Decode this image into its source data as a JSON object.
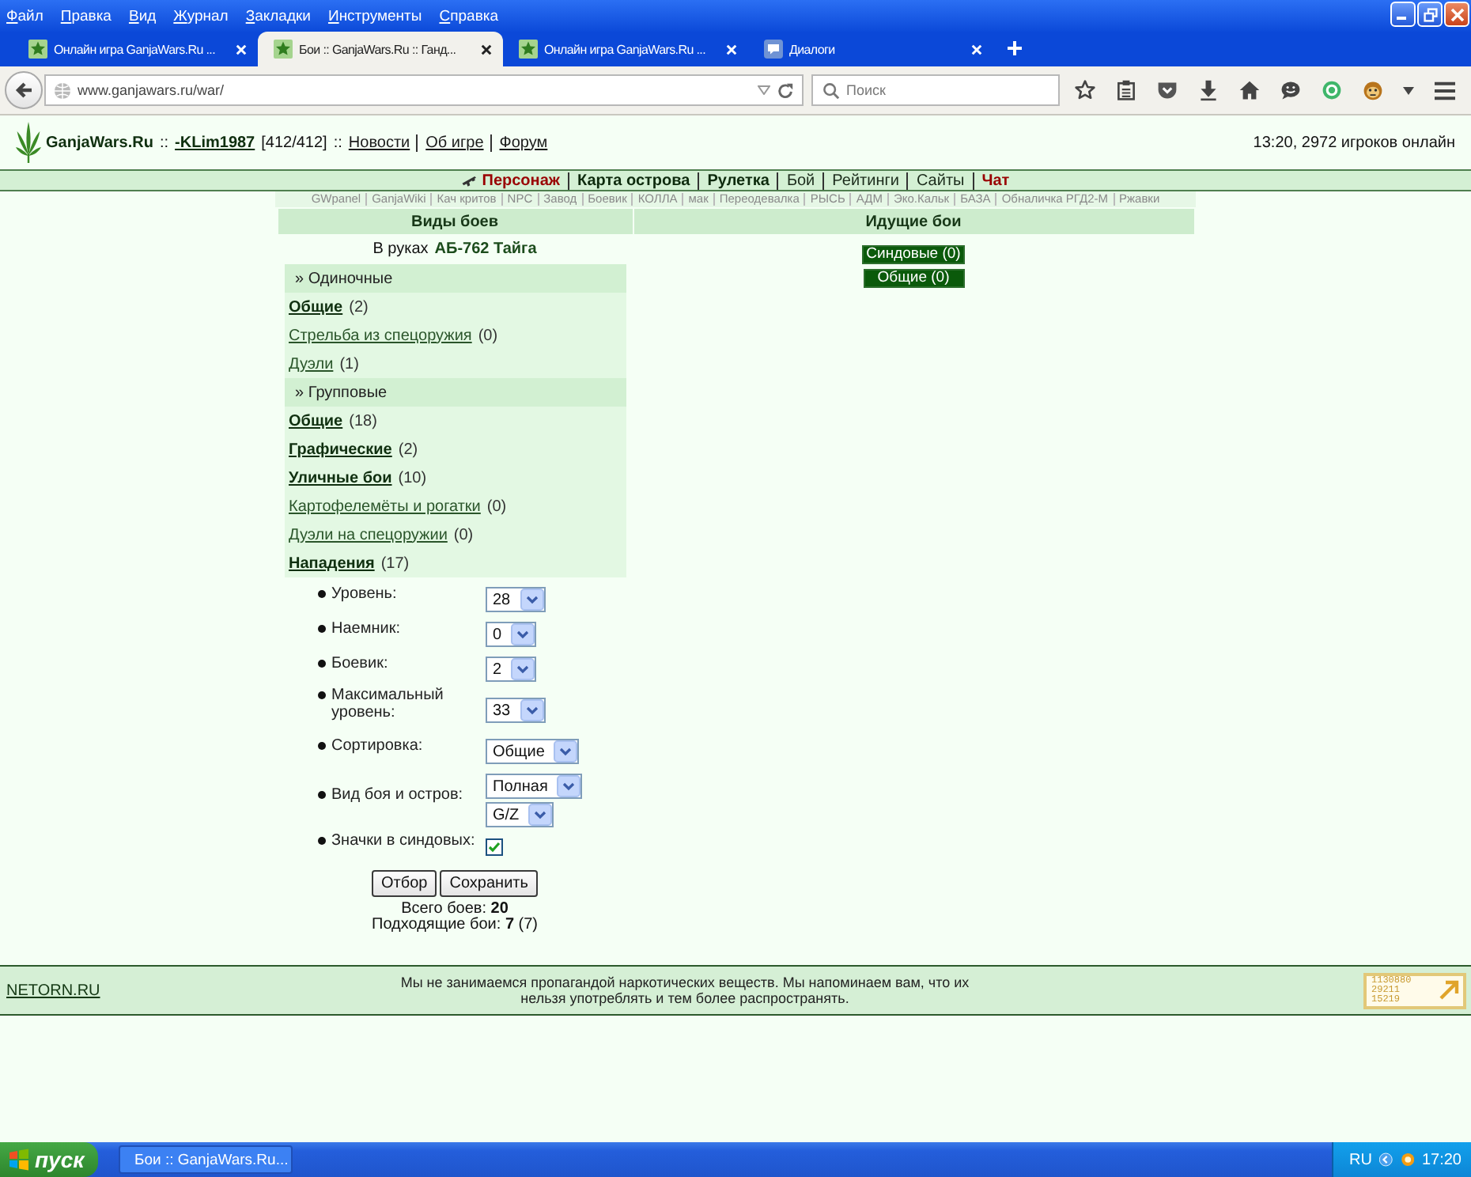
{
  "browser": {
    "menu": [
      "Файл",
      "Правка",
      "Вид",
      "Журнал",
      "Закладки",
      "Инструменты",
      "Справка"
    ],
    "tabs": [
      {
        "title": "Онлайн игра GanjaWars.Ru ...",
        "kind": "site",
        "selected": false
      },
      {
        "title": "Бои :: GanjaWars.Ru :: Ганд...",
        "kind": "site",
        "selected": true
      },
      {
        "title": "Онлайн игра GanjaWars.Ru ...",
        "kind": "site",
        "selected": false
      },
      {
        "title": "Диалоги",
        "kind": "chat",
        "selected": false
      }
    ],
    "address": "www.ganjawars.ru/war/",
    "search": {
      "placeholder": "Поиск"
    }
  },
  "header": {
    "segments": [
      {
        "kind": "brand",
        "text": "GanjaWars.Ru"
      },
      {
        "kind": "sep",
        "text": "::"
      },
      {
        "kind": "user",
        "text": "-KLim1987"
      },
      {
        "kind": "plain",
        "text": "[412/412]"
      },
      {
        "kind": "sep",
        "text": "::"
      },
      {
        "kind": "link",
        "text": "Новости"
      },
      {
        "kind": "link",
        "text": "Об игре"
      },
      {
        "kind": "link",
        "text": "Форум"
      }
    ],
    "online": "13:20, 2972 игроков онлайн"
  },
  "nav": [
    {
      "label": "Персонаж",
      "kind": "accent",
      "icon": true
    },
    {
      "label": "Карта острова",
      "kind": "bold"
    },
    {
      "label": "Рулетка",
      "kind": "bold"
    },
    {
      "label": "Бой",
      "kind": "plain"
    },
    {
      "label": "Рейтинги",
      "kind": "plain"
    },
    {
      "label": "Сайты",
      "kind": "plain"
    },
    {
      "label": "Чат",
      "kind": "accent"
    }
  ],
  "tools": [
    "GWpanel",
    "GanjaWiki",
    "Кач критов",
    "NPC",
    "Завод",
    "Боевик",
    "КОЛЛА",
    "мак",
    "Переодевалка",
    "РЫСЬ",
    "АДМ",
    "Эко.Кальк",
    "БАЗА",
    "Обналичка РГД2-М",
    "Ржавки"
  ],
  "battle_types": {
    "title": "Виды боев",
    "weapon_label": "В руках",
    "weapon": "АБ-762 Тайга",
    "groups": [
      {
        "title": "» Одиночные",
        "items": [
          {
            "label": "Общие",
            "count": "(2)",
            "emphasized": true
          },
          {
            "label": "Стрельба из спецоружия",
            "count": "(0)",
            "emphasized": false
          },
          {
            "label": "Дуэли",
            "count": "(1)",
            "emphasized": false
          }
        ]
      },
      {
        "title": "» Групповые",
        "items": [
          {
            "label": "Общие",
            "count": "(18)",
            "emphasized": true
          },
          {
            "label": "Графические",
            "count": "(2)",
            "emphasized": true
          },
          {
            "label": "Уличные бои",
            "count": "(10)",
            "emphasized": true
          },
          {
            "label": "Картофелемёты и рогатки",
            "count": "(0)",
            "emphasized": false
          },
          {
            "label": "Дуэли на спецоружии",
            "count": "(0)",
            "emphasized": false
          },
          {
            "label": "Нападения",
            "count": "(17)",
            "emphasized": true
          }
        ]
      }
    ],
    "filters": [
      {
        "kind": "select",
        "label": "Уровень:",
        "selects": [
          "28"
        ]
      },
      {
        "kind": "select",
        "label": "Наемник:",
        "selects": [
          "0"
        ]
      },
      {
        "kind": "select",
        "label": "Боевик:",
        "selects": [
          "2"
        ]
      },
      {
        "kind": "select",
        "label": "Максимальный уровень:",
        "selects": [
          "33"
        ]
      },
      {
        "kind": "select",
        "label": "Сортировка:",
        "selects": [
          "Общие"
        ]
      },
      {
        "kind": "select",
        "label": "Вид боя и остров:",
        "selects": [
          "Полная",
          "G/Z"
        ]
      },
      {
        "kind": "checkbox",
        "label": "Значки в синдовых:",
        "checked": true
      }
    ],
    "buttons": [
      "Отбор",
      "Сохранить"
    ],
    "totals": [
      "Всего боев: **20**",
      "Подходящие бои: **7** (7)"
    ]
  },
  "current_battles": {
    "title": "Идущие бои",
    "buttons": [
      "Синдовые (0)",
      "Общие (0)"
    ]
  },
  "footer": {
    "link": "NETORN.RU",
    "notice": "Мы не занимаемся пропагандой наркотических веществ. Мы напоминаем вам, что их нельзя употреблять и тем более распространять.",
    "counter": [
      "1130880",
      "29211",
      "15219"
    ]
  },
  "taskbar": {
    "start": "пуск",
    "tasks": [
      "Бои :: GanjaWars.Ru..."
    ],
    "language": "RU",
    "clock": "17:20"
  }
}
